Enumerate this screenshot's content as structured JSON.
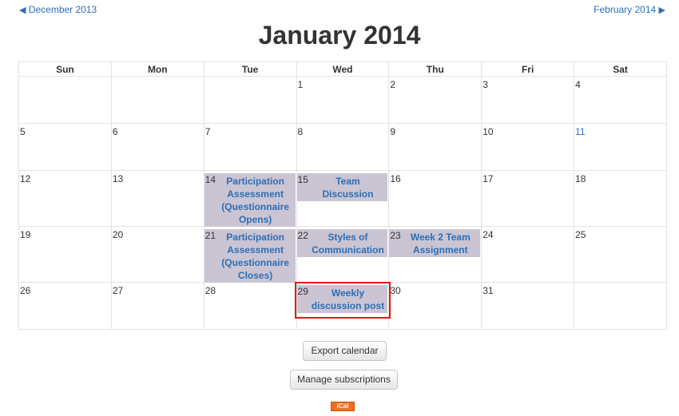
{
  "nav": {
    "prev_label": "December 2013",
    "next_label": "February 2014",
    "prev_arrow": "◀",
    "next_arrow": "▶"
  },
  "title": "January 2014",
  "weekdays": [
    "Sun",
    "Mon",
    "Tue",
    "Wed",
    "Thu",
    "Fri",
    "Sat"
  ],
  "weeks": [
    [
      {
        "day": ""
      },
      {
        "day": ""
      },
      {
        "day": ""
      },
      {
        "day": "1"
      },
      {
        "day": "2"
      },
      {
        "day": "3"
      },
      {
        "day": "4"
      }
    ],
    [
      {
        "day": "5"
      },
      {
        "day": "6"
      },
      {
        "day": "7"
      },
      {
        "day": "8"
      },
      {
        "day": "9"
      },
      {
        "day": "10"
      },
      {
        "day": "11"
      }
    ],
    [
      {
        "day": "12"
      },
      {
        "day": "13"
      },
      {
        "day": "14",
        "event": "Participation Assessment (Questionnaire Opens)"
      },
      {
        "day": "15",
        "event": "Team Discussion"
      },
      {
        "day": "16"
      },
      {
        "day": "17"
      },
      {
        "day": "18"
      }
    ],
    [
      {
        "day": "19"
      },
      {
        "day": "20"
      },
      {
        "day": "21",
        "event": "Participation Assessment (Questionnaire Closes)"
      },
      {
        "day": "22",
        "event": "Styles of Communication"
      },
      {
        "day": "23",
        "event": "Week 2 Team Assignment"
      },
      {
        "day": "24"
      },
      {
        "day": "25"
      }
    ],
    [
      {
        "day": "26"
      },
      {
        "day": "27"
      },
      {
        "day": "28"
      },
      {
        "day": "29",
        "event": "Weekly discussion post"
      },
      {
        "day": "30"
      },
      {
        "day": "31"
      },
      {
        "day": ""
      }
    ]
  ],
  "buttons": {
    "export": "Export calendar",
    "manage": "Manage subscriptions",
    "ical": "iCal"
  },
  "colors": {
    "event_bg": "#cbc4d3",
    "link": "#2a6fb8",
    "highlight": "#e11111",
    "ical_bg": "#f36d1f"
  }
}
